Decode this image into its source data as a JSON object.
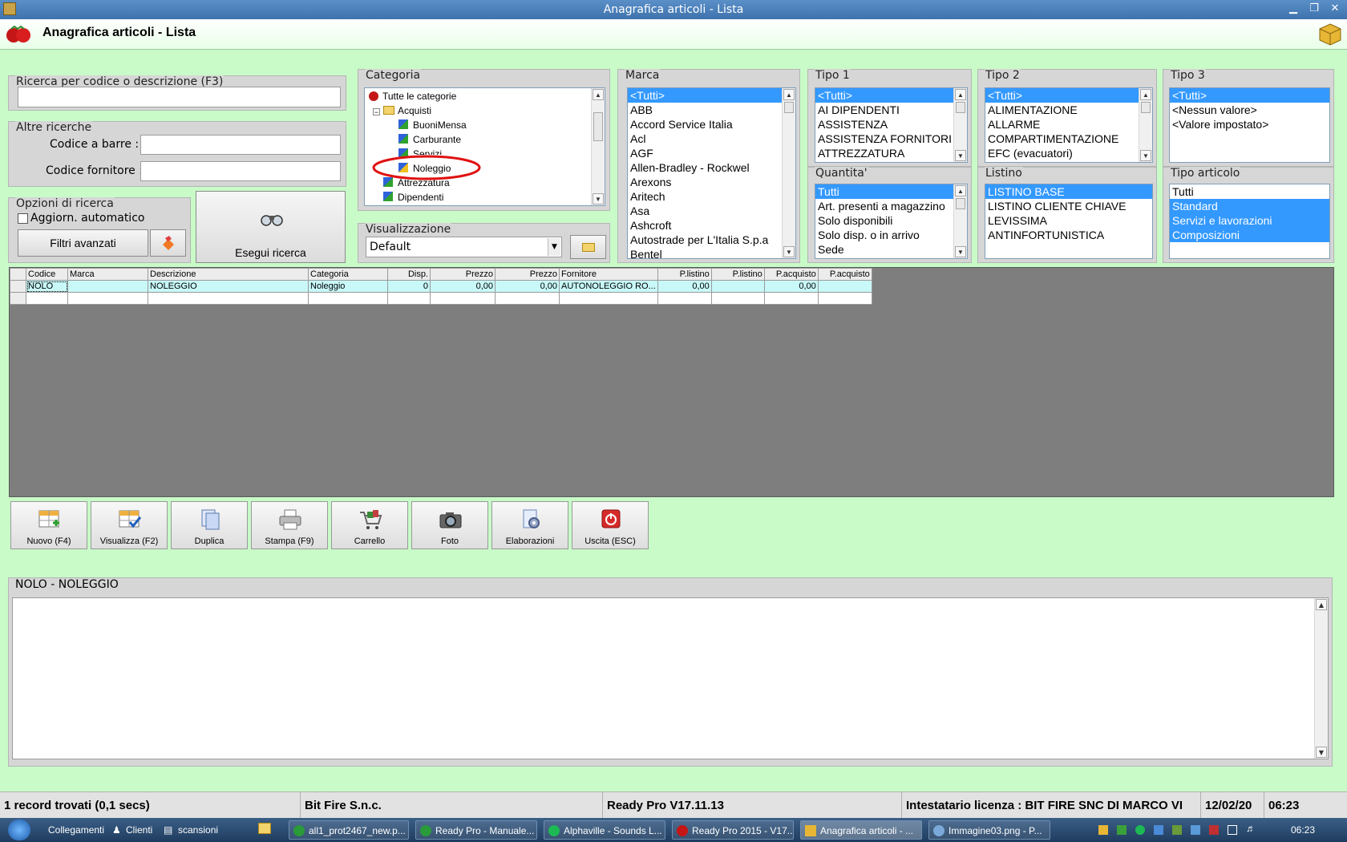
{
  "window": {
    "title": "Anagrafica articoli  - Lista"
  },
  "header": {
    "title": "Anagrafica articoli  - Lista"
  },
  "search": {
    "label": "Ricerca per codice o descrizione (F3)",
    "value": ""
  },
  "altre": {
    "label": "Altre ricerche",
    "barcode_label": "Codice a barre :",
    "supplier_code_label": "Codice fornitore :",
    "barcode_value": "",
    "supplier_value": ""
  },
  "opzioni": {
    "label": "Opzioni di ricerca",
    "auto_update_label": "Aggiorn. automatico",
    "auto_update_checked": false,
    "advanced_filters_label": "Filtri avanzati"
  },
  "esegui": {
    "label": "Esegui ricerca"
  },
  "categoria": {
    "label": "Categoria",
    "nodes": [
      "Tutte le categorie",
      "Acquisti",
      "BuoniMensa",
      "Carburante",
      "Servizi",
      "Noleggio",
      "Attrezzatura",
      "Dipendenti"
    ],
    "selected": "Noleggio"
  },
  "visualizzazione": {
    "label": "Visualizzazione",
    "value": "Default"
  },
  "marca": {
    "label": "Marca",
    "items": [
      "<Tutti>",
      "ABB",
      "Accord Service Italia",
      "Acl",
      "AGF",
      "Allen-Bradley - Rockwel",
      "Arexons",
      "Aritech",
      "Asa",
      "Ashcroft",
      "Autostrade per L'Italia S.p.a",
      "Bentel"
    ]
  },
  "tipo1": {
    "label": "Tipo 1",
    "items": [
      "<Tutti>",
      "AI DIPENDENTI",
      "ASSISTENZA",
      "ASSISTENZA FORNITORI",
      "ATTREZZATURA"
    ]
  },
  "tipo2": {
    "label": "Tipo 2",
    "items": [
      "<Tutti>",
      "ALIMENTAZIONE",
      "ALLARME",
      "COMPARTIMENTAZIONE",
      "EFC (evacuatori)"
    ]
  },
  "tipo3": {
    "label": "Tipo 3",
    "items": [
      "<Tutti>",
      "<Nessun valore>",
      "<Valore impostato>"
    ]
  },
  "quantita": {
    "label": "Quantita'",
    "items": [
      "Tutti",
      "Art. presenti a magazzino",
      "Solo disponibili",
      "Solo disp. o in arrivo",
      "Sede"
    ]
  },
  "listino": {
    "label": "Listino",
    "items": [
      "LISTINO BASE",
      "LISTINO CLIENTE CHIAVE",
      "LEVISSIMA",
      "ANTINFORTUNISTICA"
    ]
  },
  "tipo_articolo": {
    "label": "Tipo articolo",
    "items": [
      "Tutti",
      "Standard",
      "Servizi e lavorazioni",
      "Composizioni"
    ]
  },
  "grid": {
    "columns": [
      "Codice",
      "Marca",
      "Descrizione",
      "Categoria",
      "Disp.",
      "Prezzo",
      "Prezzo",
      "Fornitore",
      "P.listino",
      "P.listino",
      "P.acquisto",
      "P.acquisto"
    ],
    "rows": [
      [
        "NOLO",
        "",
        "NOLEGGIO",
        "Noleggio",
        "0",
        "0,00",
        "0,00",
        "AUTONOLEGGIO RO...",
        "0,00",
        "",
        "0,00",
        ""
      ]
    ]
  },
  "toolbar": {
    "buttons": [
      "Nuovo (F4)",
      "Visualizza (F2)",
      "Duplica",
      "Stampa (F9)",
      "Carrello",
      "Foto",
      "Elaborazioni",
      "Uscita (ESC)"
    ]
  },
  "memo": {
    "label": "NOLO - NOLEGGIO",
    "value": ""
  },
  "status": {
    "records": "1 record trovati (0,1 secs)",
    "company": "Bit Fire S.n.c.",
    "version": "Ready Pro V17.11.13",
    "license": "Intestatario licenza : BIT FIRE SNC DI MARCO VI",
    "date": "12/02/20",
    "time": "06:23"
  },
  "taskbar": {
    "quick": [
      "Collegamenti",
      "Clienti",
      "scansioni"
    ],
    "items": [
      "all1_prot2467_new.p...",
      "Ready Pro - Manuale...",
      "Alphaville - Sounds L...",
      "Ready Pro 2015 - V17...",
      "Anagrafica articoli - ...",
      "Immagine03.png - P..."
    ],
    "clock": "06:23"
  },
  "colors": {
    "background": "#c8fbc8",
    "selection": "#3399ff",
    "grid_bg": "#7e7e7e",
    "highlight_circle": "#e01010"
  }
}
